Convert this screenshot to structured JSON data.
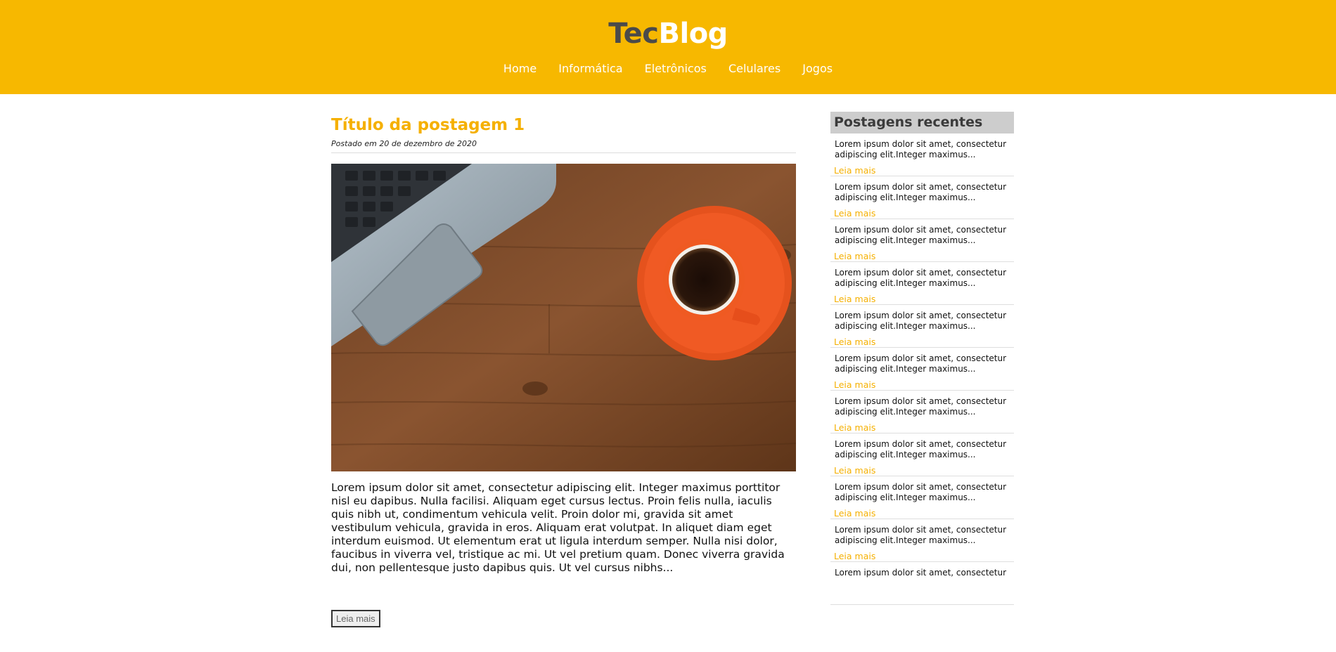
{
  "site": {
    "logo_part1": "Tec",
    "logo_part2": "Blog",
    "nav": [
      "Home",
      "Informática",
      "Eletrônicos",
      "Celulares",
      "Jogos"
    ]
  },
  "post": {
    "title": "Título da postagem 1",
    "date": "Postado em 20 de dezembro de 2020",
    "image": "laptop-and-coffee-photo",
    "text": "Lorem ipsum dolor sit amet, consectetur adipiscing elit. Integer maximus porttitor nisl eu dapibus. Nulla facilisi. Aliquam eget cursus lectus. Proin felis nulla, iaculis quis nibh ut, condimentum vehicula velit. Proin dolor mi, gravida sit amet vestibulum vehicula, gravida in eros. Aliquam erat volutpat. In aliquet diam eget interdum euismod. Ut elementum erat ut ligula interdum semper. Nulla nisi dolor, faucibus in viverra vel, tristique ac mi. Ut vel pretium quam. Donec viverra gravida dui, non pellentesque justo dapibus quis. Ut vel cursus nibhs...",
    "read_more": "Leia mais"
  },
  "sidebar": {
    "title": "Postagens recentes",
    "items": [
      {
        "text": "Lorem ipsum dolor sit amet, consectetur adipiscing elit.Integer maximus...",
        "link": "Leia mais"
      },
      {
        "text": "Lorem ipsum dolor sit amet, consectetur adipiscing elit.Integer maximus...",
        "link": "Leia mais"
      },
      {
        "text": "Lorem ipsum dolor sit amet, consectetur adipiscing elit.Integer maximus...",
        "link": "Leia mais"
      },
      {
        "text": "Lorem ipsum dolor sit amet, consectetur adipiscing elit.Integer maximus...",
        "link": "Leia mais"
      },
      {
        "text": "Lorem ipsum dolor sit amet, consectetur adipiscing elit.Integer maximus...",
        "link": "Leia mais"
      },
      {
        "text": "Lorem ipsum dolor sit amet, consectetur adipiscing elit.Integer maximus...",
        "link": "Leia mais"
      },
      {
        "text": "Lorem ipsum dolor sit amet, consectetur adipiscing elit.Integer maximus...",
        "link": "Leia mais"
      },
      {
        "text": "Lorem ipsum dolor sit amet, consectetur adipiscing elit.Integer maximus...",
        "link": "Leia mais"
      },
      {
        "text": "Lorem ipsum dolor sit amet, consectetur adipiscing elit.Integer maximus...",
        "link": "Leia mais"
      },
      {
        "text": "Lorem ipsum dolor sit amet, consectetur adipiscing elit.Integer maximus...",
        "link": "Leia mais"
      },
      {
        "text": "Lorem ipsum dolor sit amet, consectetur",
        "link": ""
      }
    ]
  },
  "colors": {
    "header_bg": "#F7B800",
    "accent": "#F5B001",
    "logo_dark": "#4a4a4a",
    "sidebar_title_bg": "#cdcdcd"
  }
}
